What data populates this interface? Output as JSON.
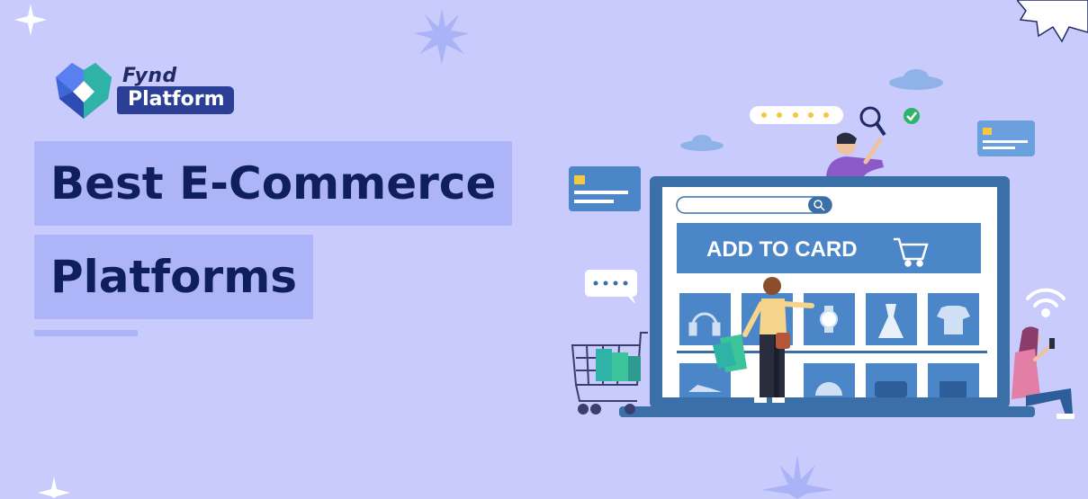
{
  "logo": {
    "brand_line1": "Fynd",
    "brand_line2": "Platform"
  },
  "headline": {
    "line1": "Best E-Commerce",
    "line2": "Platforms"
  },
  "illustration": {
    "banner_text": "ADD TO CARD"
  },
  "colors": {
    "background": "#c8cbfb",
    "headline_bg": "#aeb4f8",
    "headline_text": "#0f1f5c",
    "banner_blue": "#4a86c8",
    "screen_frame": "#3b6fa8"
  }
}
